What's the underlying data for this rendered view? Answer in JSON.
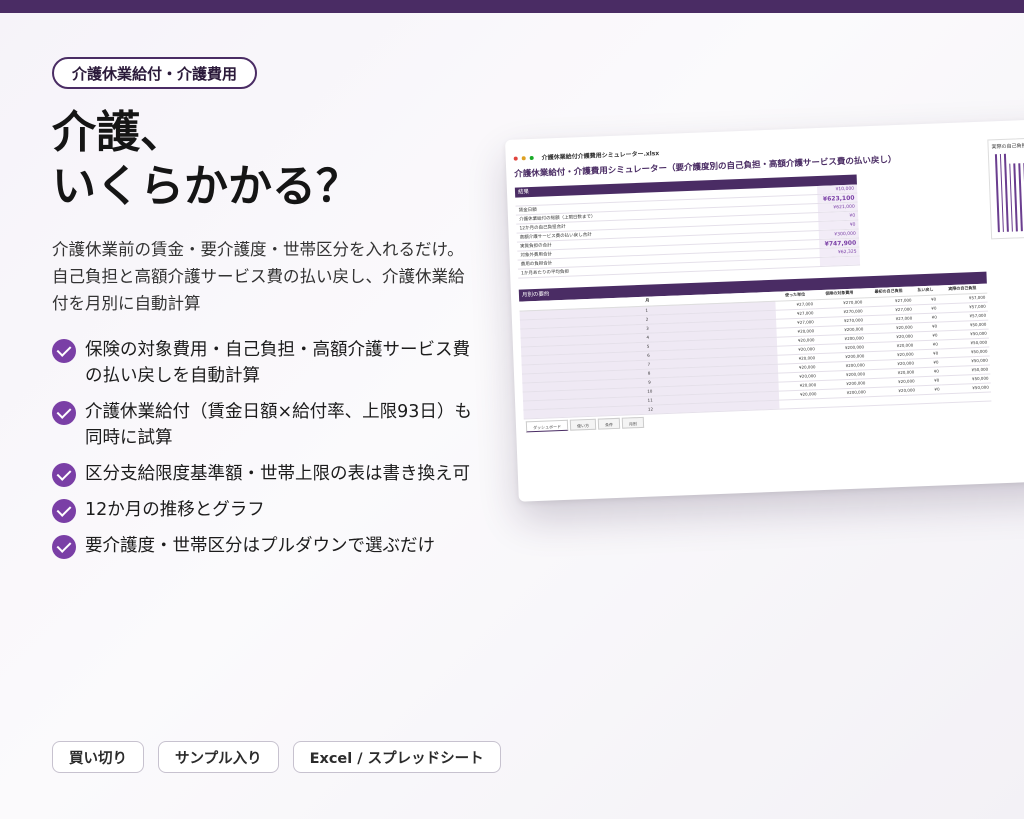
{
  "tag": "介護休業給付・介護費用",
  "headline": [
    "介護、",
    "いくらかかる？"
  ],
  "lead": [
    "介護休業前の賃金・要介護度・世帯区分を入れるだけ。",
    "自己負担と高額介護サービス費の払い戻し、介護休業給",
    "付を月別に自動計算"
  ],
  "features": [
    [
      "保険の対象費用・自己負担・高額介護サービス費",
      "の払い戻しを自動計算"
    ],
    [
      "介護休業給付（賃金日額×給付率、上限93日）も",
      "同時に試算"
    ],
    [
      "区分支給限度基準額・世帯上限の表は書き換え可"
    ],
    [
      "12か月の推移とグラフ"
    ],
    [
      "要介護度・世帯区分はプルダウンで選ぶだけ"
    ]
  ],
  "bottom_tags": [
    "買い切り",
    "サンプル入り",
    "Excel / スプレッドシート"
  ],
  "colors": {
    "accent": "#4a2c64",
    "check": "#7a3fa6"
  },
  "sheet": {
    "filename": "介護休業給付介護費用シミュレーター.xlsx",
    "heading": "介護休業給付・介護費用シミュレーター（要介護度別の自己負担・高額介護サービス費の払い戻し）",
    "summary_title": "結果",
    "summary_rows": [
      {
        "label": "",
        "value": "¥10,000",
        "big": false
      },
      {
        "label": "賃金日額",
        "value": "¥623,100",
        "big": true
      },
      {
        "label": "介護休業給付の総額（上限日数まで）",
        "value": "¥621,000",
        "big": false
      },
      {
        "label": "12か月の自己負担合計",
        "value": "¥0",
        "big": false
      },
      {
        "label": "高額介護サービス費の払い戻し合計",
        "value": "¥0",
        "big": false
      },
      {
        "label": "実質負担の合計",
        "value": "¥300,000",
        "big": false
      },
      {
        "label": "対象外費用合計",
        "value": "¥747,900",
        "big": true
      },
      {
        "label": "費用の負担合計",
        "value": "¥62,325",
        "big": false
      },
      {
        "label": "1か月あたりの平均負担",
        "value": "",
        "big": false
      }
    ],
    "monthly_title": "月別の要約",
    "monthly_headers": [
      "月",
      "使った単位",
      "保険の対象費用",
      "最初の自己負担",
      "払い戻し",
      "実際の自己負担"
    ],
    "monthly_rows": [
      [
        "1",
        "¥27,000",
        "¥270,000",
        "¥27,000",
        "¥0",
        "¥57,000"
      ],
      [
        "2",
        "¥27,000",
        "¥270,000",
        "¥27,000",
        "¥0",
        "¥57,000"
      ],
      [
        "3",
        "¥27,000",
        "¥270,000",
        "¥27,000",
        "¥0",
        "¥57,000"
      ],
      [
        "4",
        "¥20,000",
        "¥200,000",
        "¥20,000",
        "¥0",
        "¥50,000"
      ],
      [
        "5",
        "¥20,000",
        "¥200,000",
        "¥20,000",
        "¥0",
        "¥50,000"
      ],
      [
        "6",
        "¥20,000",
        "¥200,000",
        "¥20,000",
        "¥0",
        "¥50,000"
      ],
      [
        "7",
        "¥20,000",
        "¥200,000",
        "¥20,000",
        "¥0",
        "¥50,000"
      ],
      [
        "8",
        "¥20,000",
        "¥200,000",
        "¥20,000",
        "¥0",
        "¥50,000"
      ],
      [
        "9",
        "¥20,000",
        "¥200,000",
        "¥20,000",
        "¥0",
        "¥50,000"
      ],
      [
        "10",
        "¥20,000",
        "¥200,000",
        "¥20,000",
        "¥0",
        "¥50,000"
      ],
      [
        "11",
        "¥20,000",
        "¥200,000",
        "¥20,000",
        "¥0",
        "¥50,000"
      ],
      [
        "12",
        "",
        "",
        "",
        "",
        ""
      ]
    ],
    "tabs": [
      "ダッシュボード",
      "使い方",
      "条件",
      "月別"
    ],
    "chart_title": "実際の自己負担",
    "chart_values": [
      57000,
      57000,
      57000,
      50000,
      50000,
      50000,
      50000,
      50000,
      50000,
      50000,
      50000
    ]
  }
}
